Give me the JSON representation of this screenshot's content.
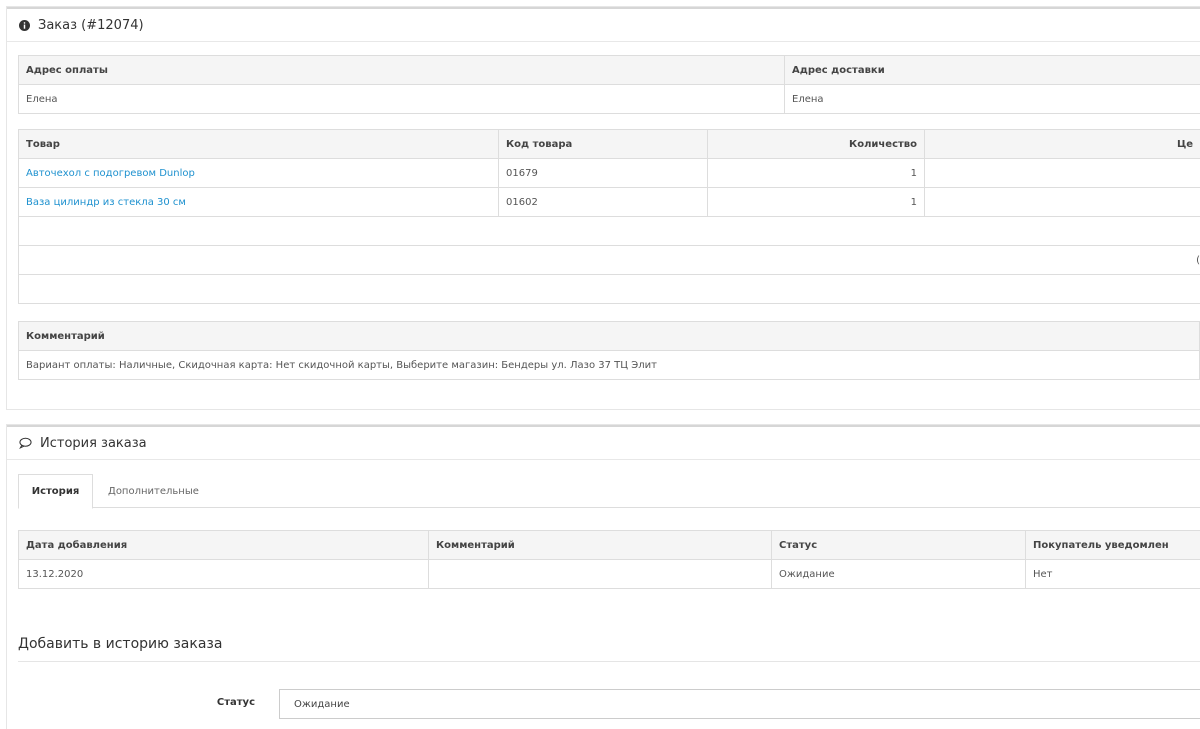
{
  "order_panel": {
    "title": "Заказ (#12074)"
  },
  "address": {
    "payment_header": "Адрес оплаты",
    "shipping_header": "Адрес доставки",
    "payment_value": "Елена",
    "shipping_value": "Елена"
  },
  "products": {
    "headers": [
      "Товар",
      "Код товара",
      "Количество",
      "Це"
    ],
    "rows": [
      {
        "name": "Авточехол с подогревом Dunlop",
        "code": "01679",
        "qty": "1"
      },
      {
        "name": "Ваза цилиндр из стекла 30 см",
        "code": "01602",
        "qty": "1"
      }
    ],
    "totals_fragment": "("
  },
  "comment": {
    "header": "Комментарий",
    "text": "Вариант оплаты: Наличные, Скидочная карта: Нет скидочной карты, Выберите магазин: Бендеры ул. Лазо 37 ТЦ Элит"
  },
  "history_panel": {
    "title": "История заказа",
    "tabs": [
      {
        "label": "История",
        "active": true
      },
      {
        "label": "Дополнительные",
        "active": false
      }
    ],
    "headers": [
      "Дата добавления",
      "Комментарий",
      "Статус",
      "Покупатель уведомлен"
    ],
    "rows": [
      {
        "date": "13.12.2020",
        "comment": "",
        "status": "Ожидание",
        "notified": "Нет"
      }
    ]
  },
  "add_history": {
    "title": "Добавить в историю заказа",
    "status_label": "Статус",
    "status_value": "Ожидание"
  }
}
